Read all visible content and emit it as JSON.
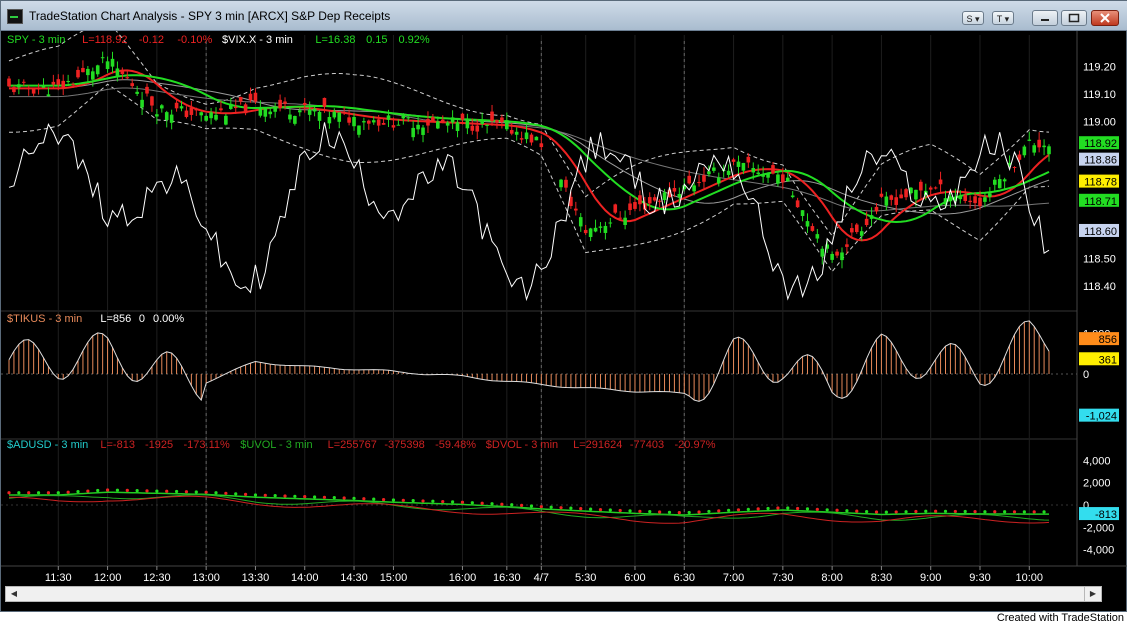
{
  "window": {
    "title": "TradeStation Chart Analysis - SPY 3 min [ARCX] S&P Dep Receipts",
    "toolbar_s_label": "S",
    "toolbar_t_label": "T",
    "minimize_icon": "minimize-icon",
    "maximize_icon": "maximize-icon",
    "close_icon": "close-icon"
  },
  "footer": {
    "credit": "Created with TradeStation"
  },
  "colors": {
    "background": "#000000",
    "bull_candle": "#22dd22",
    "bear_candle": "#ee2222",
    "axis_text": "#ffffff",
    "spy_label": "#22dd22",
    "vix_label": "#22dd22",
    "tikus_label": "#e88a5a",
    "adusd_label": "#22cccc",
    "uvol_label": "#22aa22",
    "dvol_label": "#cc2222"
  },
  "panes": {
    "price": {
      "legend": [
        {
          "text": "SPY - 3 min",
          "color": "#22dd22"
        },
        {
          "text": "L=118.92",
          "color": "#ee2222"
        },
        {
          "text": "-0.12",
          "color": "#ee2222"
        },
        {
          "text": "-0.10%",
          "color": "#ee2222"
        },
        {
          "text": "$VIX.X - 3 min",
          "color": "#ffffff"
        },
        {
          "text": "L=16.38",
          "color": "#22dd22"
        },
        {
          "text": "0.15",
          "color": "#22dd22"
        },
        {
          "text": "0.92%",
          "color": "#22dd22"
        }
      ],
      "axis_labels": [
        {
          "v": 119.2,
          "t": "119.20"
        },
        {
          "v": 119.1,
          "t": "119.10"
        },
        {
          "v": 119.0,
          "t": "119.00"
        },
        {
          "v": 118.5,
          "t": "118.50"
        },
        {
          "v": 118.4,
          "t": "118.40"
        }
      ],
      "badges": [
        {
          "v": 118.92,
          "t": "118.92",
          "bg": "#22dd22",
          "fg": "#000000"
        },
        {
          "v": 118.86,
          "t": "118.86",
          "bg": "#c8d4f0",
          "fg": "#000000"
        },
        {
          "v": 118.78,
          "t": "118.78",
          "bg": "#ffee00",
          "fg": "#000000"
        },
        {
          "v": 118.71,
          "t": "118.71",
          "bg": "#22dd22",
          "fg": "#000000"
        },
        {
          "v": 118.6,
          "t": "118.60",
          "bg": "#c8d4f0",
          "fg": "#000000"
        }
      ]
    },
    "tikus": {
      "legend": [
        {
          "text": "$TIKUS - 3 min",
          "color": "#e88a5a"
        },
        {
          "text": "L=856",
          "color": "#ffffff"
        },
        {
          "text": "0",
          "color": "#ffffff"
        },
        {
          "text": "0.00%",
          "color": "#ffffff"
        }
      ],
      "axis_labels": [
        {
          "v": 1000,
          "t": "1,000"
        },
        {
          "v": 0,
          "t": "0"
        }
      ],
      "badges": [
        {
          "v": 856,
          "t": "856",
          "bg": "#ff8c1a",
          "fg": "#000000"
        },
        {
          "v": 361,
          "t": "361",
          "bg": "#ffee00",
          "fg": "#000000"
        },
        {
          "v": -1024,
          "t": "-1,024",
          "bg": "#33ddee",
          "fg": "#000000"
        }
      ]
    },
    "breadth": {
      "legend": [
        {
          "text": "$ADUSD - 3 min",
          "color": "#22cccc"
        },
        {
          "text": "L=-813",
          "color": "#cc2222"
        },
        {
          "text": "-1925",
          "color": "#cc2222"
        },
        {
          "text": "-173.11%",
          "color": "#cc2222"
        },
        {
          "text": "$UVOL - 3 min",
          "color": "#22aa22"
        },
        {
          "text": "L=255767",
          "color": "#cc2222"
        },
        {
          "text": "-375398",
          "color": "#cc2222"
        },
        {
          "text": "-59.48%",
          "color": "#cc2222"
        },
        {
          "text": "$DVOL - 3 min",
          "color": "#cc2222"
        },
        {
          "text": "L=291624",
          "color": "#cc2222"
        },
        {
          "text": "-77403",
          "color": "#cc2222"
        },
        {
          "text": "-20.97%",
          "color": "#cc2222"
        }
      ],
      "axis_labels": [
        {
          "v": 4000,
          "t": "4,000"
        },
        {
          "v": 2000,
          "t": "2,000"
        },
        {
          "v": 0,
          "t": "0"
        },
        {
          "v": -2000,
          "t": "-2,000"
        },
        {
          "v": -4000,
          "t": "-4,000"
        }
      ],
      "badges": [
        {
          "v": -813,
          "t": "-813",
          "bg": "#33ddee",
          "fg": "#000000"
        }
      ]
    }
  },
  "time_axis": [
    {
      "t": "11:30",
      "i": 10
    },
    {
      "t": "12:00",
      "i": 20
    },
    {
      "t": "12:30",
      "i": 30
    },
    {
      "t": "13:00",
      "i": 40
    },
    {
      "t": "13:30",
      "i": 50
    },
    {
      "t": "14:00",
      "i": 60
    },
    {
      "t": "14:30",
      "i": 70
    },
    {
      "t": "15:00",
      "i": 78
    },
    {
      "t": "16:00",
      "i": 92
    },
    {
      "t": "16:30",
      "i": 101
    },
    {
      "t": "4/7",
      "i": 108
    },
    {
      "t": "5:30",
      "i": 117
    },
    {
      "t": "6:00",
      "i": 127
    },
    {
      "t": "6:30",
      "i": 137
    },
    {
      "t": "7:00",
      "i": 147
    },
    {
      "t": "7:30",
      "i": 157
    },
    {
      "t": "8:00",
      "i": 167
    },
    {
      "t": "8:30",
      "i": 177
    },
    {
      "t": "9:00",
      "i": 187
    },
    {
      "t": "9:30",
      "i": 197
    },
    {
      "t": "10:00",
      "i": 207
    }
  ],
  "chart_data": {
    "type": "line",
    "title": "",
    "x": [
      "11:30",
      "12:00",
      "12:30",
      "13:00",
      "13:30",
      "14:00",
      "14:30",
      "15:00",
      "16:00",
      "16:30",
      "4/7",
      "5:30",
      "6:00",
      "6:30",
      "7:00",
      "7:30",
      "8:00",
      "8:30",
      "9:00",
      "9:30",
      "10:00"
    ],
    "series": [
      {
        "name": "SPY - 3 min",
        "values": [
          119.12,
          119.22,
          119.05,
          119.02,
          119.06,
          119.04,
          119.01,
          119.0,
          118.99,
          118.98,
          118.92,
          118.6,
          118.68,
          118.76,
          118.84,
          118.8,
          118.5,
          118.7,
          118.76,
          118.7,
          118.92
        ]
      },
      {
        "name": "$TIKUS - 3 min",
        "values": [
          350,
          550,
          120,
          -200,
          300,
          180,
          120,
          60,
          -60,
          -180,
          -260,
          -350,
          -420,
          -480,
          420,
          260,
          -280,
          480,
          350,
          120,
          856
        ]
      },
      {
        "name": "$ADUSD - 3 min",
        "values": [
          900,
          1150,
          1050,
          950,
          700,
          550,
          400,
          250,
          50,
          -150,
          -350,
          -550,
          -750,
          -900,
          -650,
          -450,
          -650,
          -850,
          -750,
          -800,
          -813
        ]
      }
    ],
    "y_ranges": {
      "price": [
        118.33,
        119.3
      ],
      "tikus": [
        -1450,
        1350
      ],
      "breadth": [
        -5200,
        5200
      ]
    }
  }
}
